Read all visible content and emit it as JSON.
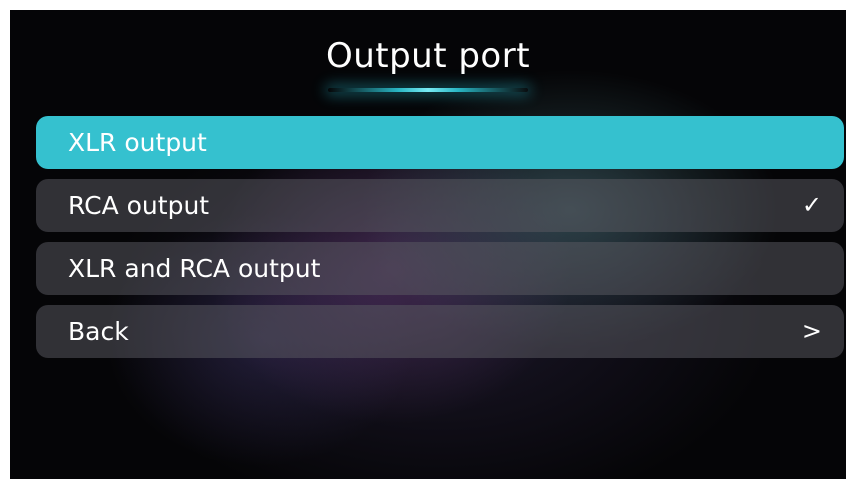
{
  "screen": {
    "title": "Output port",
    "accent_color": "#35c1cf",
    "menu": [
      {
        "label": "XLR output",
        "selected": true,
        "checked": false,
        "indicator_icon": "",
        "indicator_glyph": ""
      },
      {
        "label": "RCA output",
        "selected": false,
        "checked": true,
        "indicator_icon": "checkmark-icon",
        "indicator_glyph": "✓"
      },
      {
        "label": "XLR and RCA output",
        "selected": false,
        "checked": false,
        "indicator_icon": "",
        "indicator_glyph": ""
      },
      {
        "label": "Back",
        "selected": false,
        "checked": false,
        "indicator_icon": "chevron-right-icon",
        "indicator_glyph": ">"
      }
    ]
  }
}
